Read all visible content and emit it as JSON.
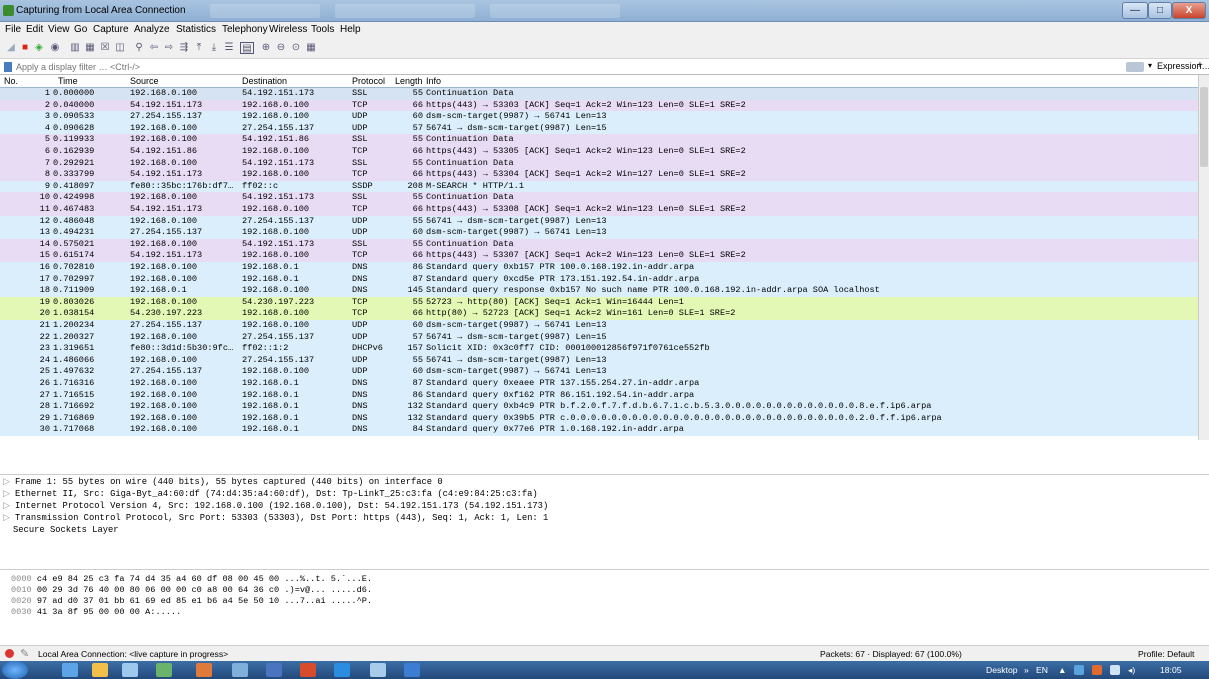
{
  "window": {
    "title": "Capturing from Local Area Connection",
    "min": "—",
    "max": "□",
    "close": "X"
  },
  "menu": [
    "File",
    "Edit",
    "View",
    "Go",
    "Capture",
    "Analyze",
    "Statistics",
    "Telephony",
    "Wireless",
    "Tools",
    "Help"
  ],
  "filter": {
    "placeholder": "Apply a display filter … <Ctrl-/>",
    "expression_label": "Expression…",
    "add_label": "+"
  },
  "columns": {
    "no": "No.",
    "time": "Time",
    "source": "Source",
    "destination": "Destination",
    "protocol": "Protocol",
    "length": "Length",
    "info": "Info"
  },
  "packets": [
    {
      "no": "1",
      "time": "0.000000",
      "src": "192.168.0.100",
      "dst": "54.192.151.173",
      "proto": "SSL",
      "len": "55",
      "info": "Continuation Data"
    },
    {
      "no": "2",
      "time": "0.040000",
      "src": "54.192.151.173",
      "dst": "192.168.0.100",
      "proto": "TCP",
      "len": "66",
      "info": "https(443) → 53303 [ACK] Seq=1 Ack=2 Win=123 Len=0 SLE=1 SRE=2"
    },
    {
      "no": "3",
      "time": "0.090533",
      "src": "27.254.155.137",
      "dst": "192.168.0.100",
      "proto": "UDP",
      "len": "60",
      "info": "dsm-scm-target(9987) → 56741 Len=13"
    },
    {
      "no": "4",
      "time": "0.090628",
      "src": "192.168.0.100",
      "dst": "27.254.155.137",
      "proto": "UDP",
      "len": "57",
      "info": "56741 → dsm-scm-target(9987) Len=15"
    },
    {
      "no": "5",
      "time": "0.119933",
      "src": "192.168.0.100",
      "dst": "54.192.151.86",
      "proto": "SSL",
      "len": "55",
      "info": "Continuation Data"
    },
    {
      "no": "6",
      "time": "0.162939",
      "src": "54.192.151.86",
      "dst": "192.168.0.100",
      "proto": "TCP",
      "len": "66",
      "info": "https(443) → 53305 [ACK] Seq=1 Ack=2 Win=123 Len=0 SLE=1 SRE=2"
    },
    {
      "no": "7",
      "time": "0.292921",
      "src": "192.168.0.100",
      "dst": "54.192.151.173",
      "proto": "SSL",
      "len": "55",
      "info": "Continuation Data"
    },
    {
      "no": "8",
      "time": "0.333799",
      "src": "54.192.151.173",
      "dst": "192.168.0.100",
      "proto": "TCP",
      "len": "66",
      "info": "https(443) → 53304 [ACK] Seq=1 Ack=2 Win=127 Len=0 SLE=1 SRE=2"
    },
    {
      "no": "9",
      "time": "0.418097",
      "src": "fe80::35bc:176b:df7…",
      "dst": "ff02::c",
      "proto": "SSDP",
      "len": "208",
      "info": "M-SEARCH * HTTP/1.1"
    },
    {
      "no": "10",
      "time": "0.424998",
      "src": "192.168.0.100",
      "dst": "54.192.151.173",
      "proto": "SSL",
      "len": "55",
      "info": "Continuation Data"
    },
    {
      "no": "11",
      "time": "0.467483",
      "src": "54.192.151.173",
      "dst": "192.168.0.100",
      "proto": "TCP",
      "len": "66",
      "info": "https(443) → 53308 [ACK] Seq=1 Ack=2 Win=123 Len=0 SLE=1 SRE=2"
    },
    {
      "no": "12",
      "time": "0.486048",
      "src": "192.168.0.100",
      "dst": "27.254.155.137",
      "proto": "UDP",
      "len": "55",
      "info": "56741 → dsm-scm-target(9987) Len=13"
    },
    {
      "no": "13",
      "time": "0.494231",
      "src": "27.254.155.137",
      "dst": "192.168.0.100",
      "proto": "UDP",
      "len": "60",
      "info": "dsm-scm-target(9987) → 56741 Len=13"
    },
    {
      "no": "14",
      "time": "0.575021",
      "src": "192.168.0.100",
      "dst": "54.192.151.173",
      "proto": "SSL",
      "len": "55",
      "info": "Continuation Data"
    },
    {
      "no": "15",
      "time": "0.615174",
      "src": "54.192.151.173",
      "dst": "192.168.0.100",
      "proto": "TCP",
      "len": "66",
      "info": "https(443) → 53307 [ACK] Seq=1 Ack=2 Win=123 Len=0 SLE=1 SRE=2"
    },
    {
      "no": "16",
      "time": "0.702810",
      "src": "192.168.0.100",
      "dst": "192.168.0.1",
      "proto": "DNS",
      "len": "86",
      "info": "Standard query 0xb157 PTR 100.0.168.192.in-addr.arpa"
    },
    {
      "no": "17",
      "time": "0.702997",
      "src": "192.168.0.100",
      "dst": "192.168.0.1",
      "proto": "DNS",
      "len": "87",
      "info": "Standard query 0xcd5e PTR 173.151.192.54.in-addr.arpa"
    },
    {
      "no": "18",
      "time": "0.711909",
      "src": "192.168.0.1",
      "dst": "192.168.0.100",
      "proto": "DNS",
      "len": "145",
      "info": "Standard query response 0xb157 No such name PTR 100.0.168.192.in-addr.arpa SOA localhost"
    },
    {
      "no": "19",
      "time": "0.803026",
      "src": "192.168.0.100",
      "dst": "54.230.197.223",
      "proto": "TCP",
      "len": "55",
      "info": "52723 → http(80) [ACK] Seq=1 Ack=1 Win=16444 Len=1"
    },
    {
      "no": "20",
      "time": "1.038154",
      "src": "54.230.197.223",
      "dst": "192.168.0.100",
      "proto": "TCP",
      "len": "66",
      "info": "http(80) → 52723 [ACK] Seq=1 Ack=2 Win=161 Len=0 SLE=1 SRE=2"
    },
    {
      "no": "21",
      "time": "1.200234",
      "src": "27.254.155.137",
      "dst": "192.168.0.100",
      "proto": "UDP",
      "len": "60",
      "info": "dsm-scm-target(9987) → 56741 Len=13"
    },
    {
      "no": "22",
      "time": "1.200327",
      "src": "192.168.0.100",
      "dst": "27.254.155.137",
      "proto": "UDP",
      "len": "57",
      "info": "56741 → dsm-scm-target(9987) Len=15"
    },
    {
      "no": "23",
      "time": "1.319651",
      "src": "fe80::3d1d:5b30:9fc…",
      "dst": "ff02::1:2",
      "proto": "DHCPv6",
      "len": "157",
      "info": "Solicit XID: 0x3c0ff7 CID: 000100012856f971f0761ce552fb"
    },
    {
      "no": "24",
      "time": "1.486066",
      "src": "192.168.0.100",
      "dst": "27.254.155.137",
      "proto": "UDP",
      "len": "55",
      "info": "56741 → dsm-scm-target(9987) Len=13"
    },
    {
      "no": "25",
      "time": "1.497632",
      "src": "27.254.155.137",
      "dst": "192.168.0.100",
      "proto": "UDP",
      "len": "60",
      "info": "dsm-scm-target(9987) → 56741 Len=13"
    },
    {
      "no": "26",
      "time": "1.716316",
      "src": "192.168.0.100",
      "dst": "192.168.0.1",
      "proto": "DNS",
      "len": "87",
      "info": "Standard query 0xeaee PTR 137.155.254.27.in-addr.arpa"
    },
    {
      "no": "27",
      "time": "1.716515",
      "src": "192.168.0.100",
      "dst": "192.168.0.1",
      "proto": "DNS",
      "len": "86",
      "info": "Standard query 0xf162 PTR 86.151.192.54.in-addr.arpa"
    },
    {
      "no": "28",
      "time": "1.716692",
      "src": "192.168.0.100",
      "dst": "192.168.0.1",
      "proto": "DNS",
      "len": "132",
      "info": "Standard query 0xb4c9 PTR b.f.2.0.f.7.f.d.b.6.7.1.c.b.5.3.0.0.0.0.0.0.0.0.0.0.0.0.0.8.e.f.ip6.arpa"
    },
    {
      "no": "29",
      "time": "1.716869",
      "src": "192.168.0.100",
      "dst": "192.168.0.1",
      "proto": "DNS",
      "len": "132",
      "info": "Standard query 0x39b5 PTR c.0.0.0.0.0.0.0.0.0.0.0.0.0.0.0.0.0.0.0.0.0.0.0.0.0.0.0.0.2.0.f.f.ip6.arpa"
    },
    {
      "no": "30",
      "time": "1.717068",
      "src": "192.168.0.100",
      "dst": "192.168.0.1",
      "proto": "DNS",
      "len": "84",
      "info": "Standard query 0x77e6 PTR 1.0.168.192.in-addr.arpa"
    }
  ],
  "details": [
    "Frame 1: 55 bytes on wire (440 bits), 55 bytes captured (440 bits) on interface 0",
    "Ethernet II, Src: Giga-Byt_a4:60:df (74:d4:35:a4:60:df), Dst: Tp-LinkT_25:c3:fa (c4:e9:84:25:c3:fa)",
    "Internet Protocol Version 4, Src: 192.168.0.100 (192.168.0.100), Dst: 54.192.151.173 (54.192.151.173)",
    "Transmission Control Protocol, Src Port: 53303 (53303), Dst Port: https (443), Seq: 1, Ack: 1, Len: 1",
    "Secure Sockets Layer"
  ],
  "bytes": [
    {
      "off": "0000",
      "hex": "c4 e9 84 25 c3 fa 74 d4  35 a4 60 df 08 00 45 00",
      "ascii": "...%..t. 5.`...E."
    },
    {
      "off": "0010",
      "hex": "00 29 3d 76 40 00 80 06  00 00 c0 a8 00 64 36 c0",
      "ascii": ".)=v@... .....d6."
    },
    {
      "off": "0020",
      "hex": "97 ad d0 37 01 bb 61 69  ed 85 e1 b6 a4 5e 50 10",
      "ascii": "...7..ai .....^P."
    },
    {
      "off": "0030",
      "hex": "41 3a 8f 95 00 00 00",
      "ascii": "A:....."
    }
  ],
  "status": {
    "interface": "Local Area Connection: <live capture in progress>",
    "packets": "Packets: 67 · Displayed: 67 (100.0%)",
    "profile": "Profile: Default"
  },
  "taskbar": {
    "desktop": "Desktop",
    "lang": "EN",
    "time": "18:05"
  },
  "colors": {
    "ssl_tcp": "#e8dcf5",
    "udp_dns": "#dbeefc",
    "green": "#e3f8b4",
    "selected": "#d6e3f2"
  }
}
